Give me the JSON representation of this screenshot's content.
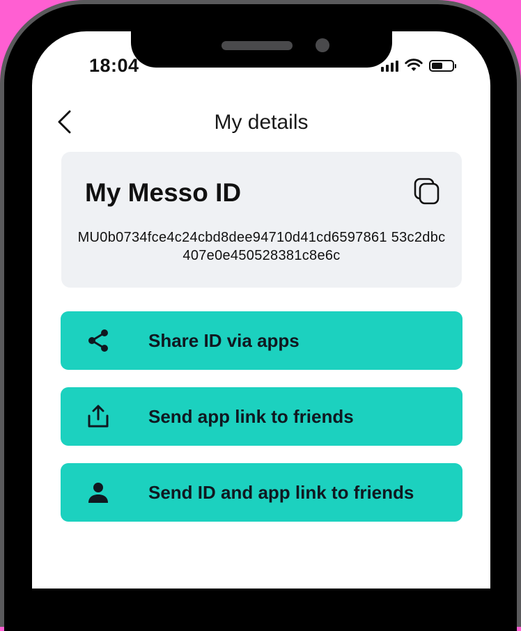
{
  "status_bar": {
    "time": "18:04",
    "icons": [
      "signal-icon",
      "wifi-icon",
      "battery-icon"
    ]
  },
  "header": {
    "title": "My details",
    "back_icon": "chevron-left-icon"
  },
  "id_card": {
    "heading": "My Messo ID",
    "id_value": "MU0b0734fce4c24cbd8dee94710d41cd6597861 53c2dbc407e0e450528381c8e6c",
    "copy_icon": "copy-icon"
  },
  "actions": [
    {
      "label": "Share ID via apps",
      "icon": "share-icon"
    },
    {
      "label": "Send app link to friends",
      "icon": "upload-icon"
    },
    {
      "label": "Send ID and app link to friends",
      "icon": "person-icon"
    }
  ],
  "colors": {
    "accent": "#1cd1bf",
    "card_bg": "#eff1f4",
    "background": "#ff5fd2"
  }
}
